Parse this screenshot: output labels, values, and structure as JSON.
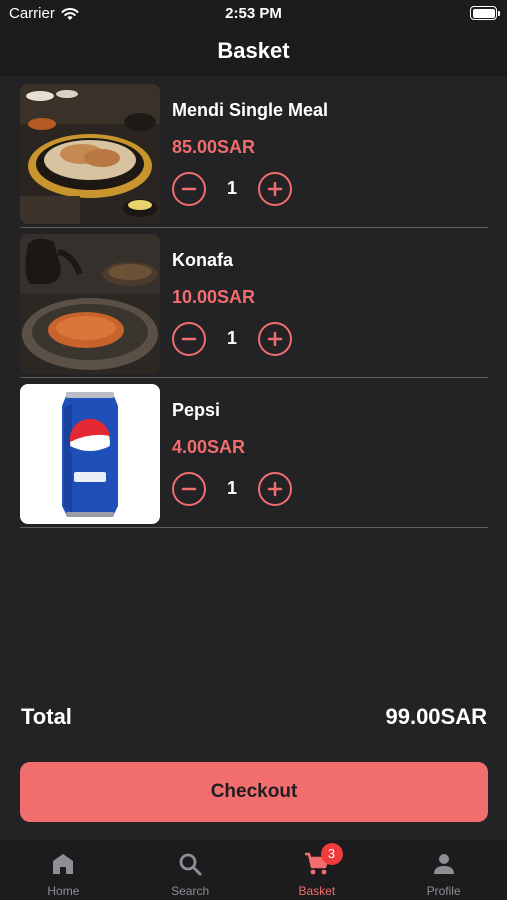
{
  "status_bar": {
    "carrier": "Carrier",
    "time": "2:53 PM"
  },
  "header": {
    "title": "Basket"
  },
  "items": [
    {
      "name": "Mendi Single Meal",
      "price": "85.00SAR",
      "quantity": "1",
      "image": "mandi-rice-plate"
    },
    {
      "name": "Konafa",
      "price": "10.00SAR",
      "quantity": "1",
      "image": "konafa-dessert-plate"
    },
    {
      "name": "Pepsi",
      "price": "4.00SAR",
      "quantity": "1",
      "image": "pepsi-can"
    }
  ],
  "summary": {
    "total_label": "Total",
    "total_value": "99.00SAR"
  },
  "checkout": {
    "label": "Checkout"
  },
  "tabbar": {
    "tabs": [
      {
        "label": "Home",
        "icon": "home-icon"
      },
      {
        "label": "Search",
        "icon": "search-icon"
      },
      {
        "label": "Basket",
        "icon": "cart-icon",
        "badge": "3",
        "active": true
      },
      {
        "label": "Profile",
        "icon": "person-icon"
      }
    ]
  },
  "colors": {
    "accent": "#f26d6d",
    "background": "#232326",
    "bar": "#1c1c1e",
    "badge": "#ef3b3b"
  }
}
